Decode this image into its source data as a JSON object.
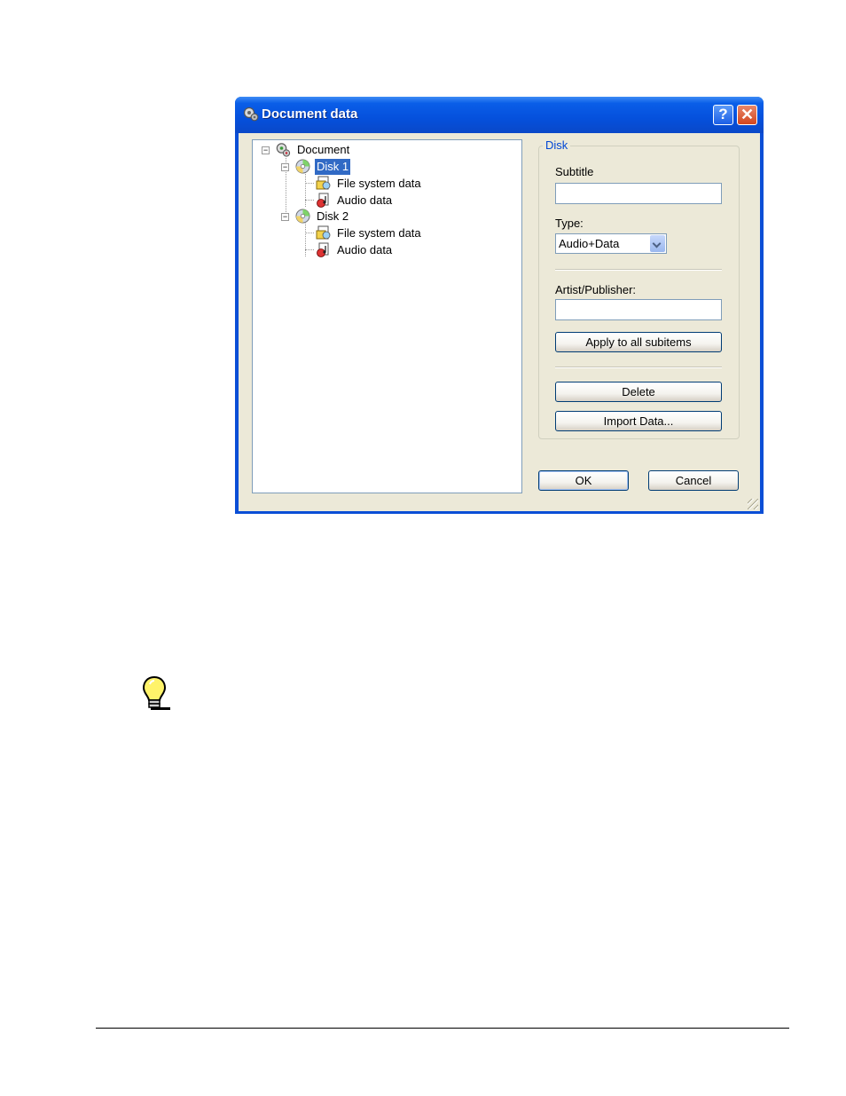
{
  "window": {
    "title": "Document data"
  },
  "tree": {
    "document_label": "Document",
    "disks": [
      {
        "label": "Disk 1",
        "selected": true,
        "children": [
          "File system data",
          "Audio data"
        ]
      },
      {
        "label": "Disk 2",
        "selected": false,
        "children": [
          "File system data",
          "Audio data"
        ]
      }
    ]
  },
  "disk_group": {
    "legend": "Disk",
    "subtitle_label": "Subtitle",
    "subtitle_value": "",
    "type_label": "Type:",
    "type_value": "Audio+Data",
    "artist_label": "Artist/Publisher:",
    "artist_value": "",
    "apply_label": "Apply to all subitems",
    "delete_label": "Delete",
    "import_label": "Import Data..."
  },
  "buttons": {
    "ok": "OK",
    "cancel": "Cancel"
  },
  "colors": {
    "titlebar": "#0a5ee8",
    "selection": "#316ac5",
    "group_legend": "#0046d5",
    "dialog_bg": "#ece9d8"
  },
  "icons": {
    "title": "settings-gears-icon",
    "document": "settings-gears-icon",
    "disk": "cd-disc-icon",
    "file_system": "folder-document-icon",
    "audio": "audio-document-icon",
    "tip": "lightbulb-icon"
  }
}
